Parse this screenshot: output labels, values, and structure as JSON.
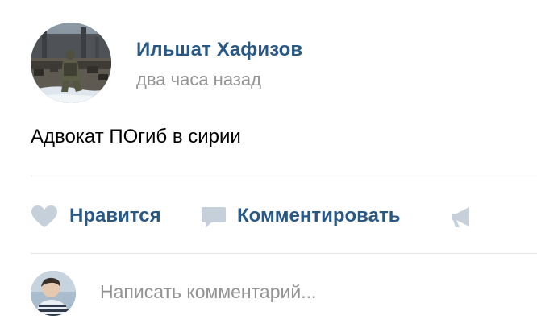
{
  "post": {
    "author": {
      "name": "Ильшат Хафизов",
      "avatar_icon": "soldier-photo-avatar"
    },
    "time": "два часа назад",
    "text": "Адвокат ПОгиб в сирии"
  },
  "actions": {
    "like": {
      "label": "Нравится",
      "icon": "heart-icon"
    },
    "comment": {
      "label": "Комментировать",
      "icon": "comment-bubble-icon"
    },
    "share": {
      "icon": "megaphone-icon"
    }
  },
  "composer": {
    "placeholder": "Написать комментарий...",
    "avatar_icon": "user-photo-avatar"
  },
  "colors": {
    "link": "#2a5885",
    "muted": "#939393",
    "icon": "#c5d0db",
    "divider": "#e1e5eb"
  }
}
